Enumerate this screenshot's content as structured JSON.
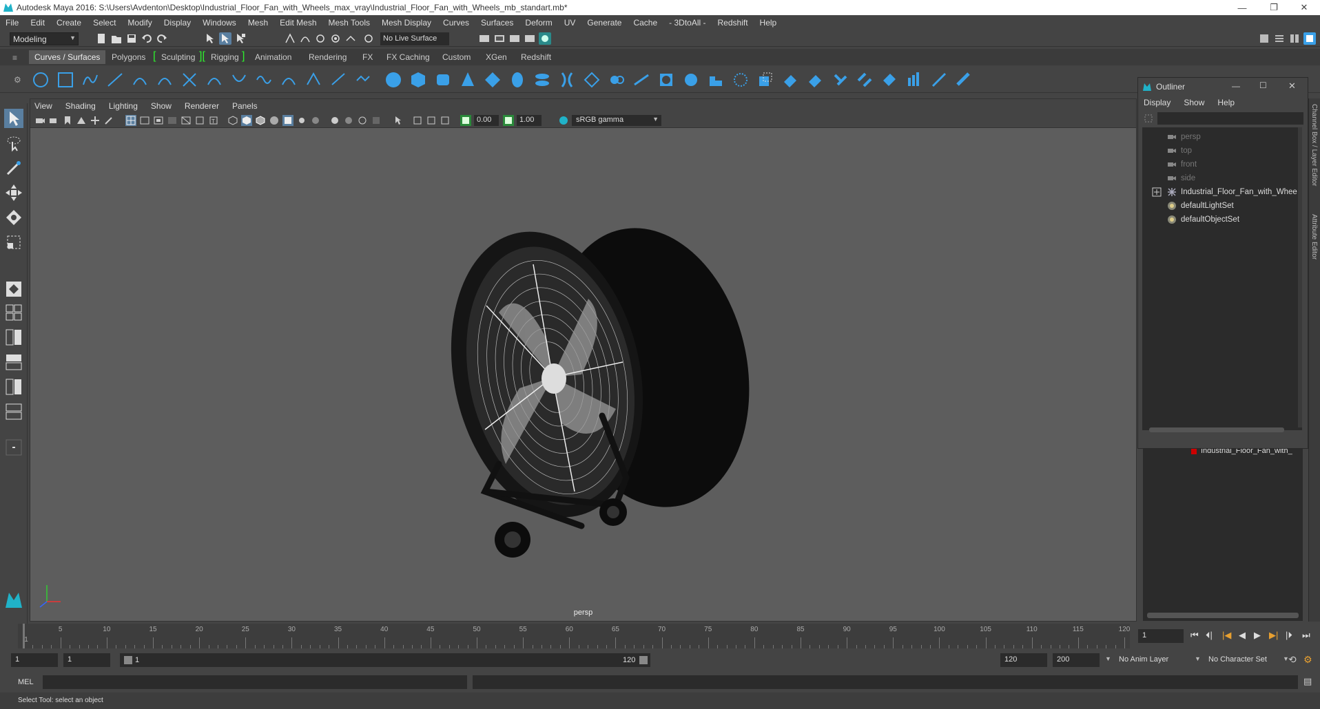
{
  "window": {
    "title": "Autodesk Maya 2016: S:\\Users\\Avdenton\\Desktop\\Industrial_Floor_Fan_with_Wheels_max_vray\\Industrial_Floor_Fan_with_Wheels_mb_standart.mb*",
    "minimize": "—",
    "maximize": "❐",
    "close": "✕"
  },
  "menubar": [
    "File",
    "Edit",
    "Create",
    "Select",
    "Modify",
    "Display",
    "Windows",
    "Mesh",
    "Edit Mesh",
    "Mesh Tools",
    "Mesh Display",
    "Curves",
    "Surfaces",
    "Deform",
    "UV",
    "Generate",
    "Cache",
    "- 3DtoAll -",
    "Redshift",
    "Help"
  ],
  "statusline": {
    "mode": "Modeling",
    "live_surface": "No Live Surface"
  },
  "shelf_tabs": [
    "Curves / Surfaces",
    "Polygons",
    "Sculpting",
    "Rigging",
    "Animation",
    "Rendering",
    "FX",
    "FX Caching",
    "Custom",
    "XGen",
    "Redshift"
  ],
  "viewport": {
    "menu": [
      "View",
      "Shading",
      "Lighting",
      "Show",
      "Renderer",
      "Panels"
    ],
    "exposure": "0.00",
    "gamma": "1.00",
    "color_space": "sRGB gamma",
    "camera": "persp"
  },
  "outliner": {
    "title": "Outliner",
    "menu": [
      "Display",
      "Show",
      "Help"
    ],
    "items": [
      {
        "label": "persp",
        "dim": true,
        "icon": "camera-icon"
      },
      {
        "label": "top",
        "dim": true,
        "icon": "camera-icon"
      },
      {
        "label": "front",
        "dim": true,
        "icon": "camera-icon"
      },
      {
        "label": "side",
        "dim": true,
        "icon": "camera-icon"
      },
      {
        "label": "Industrial_Floor_Fan_with_Whee",
        "dim": false,
        "icon": "group-icon"
      },
      {
        "label": "defaultLightSet",
        "dim": false,
        "icon": "set-icon"
      },
      {
        "label": "defaultObjectSet",
        "dim": false,
        "icon": "set-icon"
      }
    ]
  },
  "layer_panel": {
    "layer_name": "Industrial_Floor_Fan_with_"
  },
  "right_strip": {
    "channel_box": "Channel Box / Layer Editor",
    "attribute_editor": "Attribute Editor"
  },
  "timeslider": {
    "ticks": [
      1,
      5,
      10,
      15,
      20,
      25,
      30,
      35,
      40,
      45,
      50,
      55,
      60,
      65,
      70,
      75,
      80,
      85,
      90,
      95,
      100,
      105,
      110,
      115,
      120
    ],
    "current_frame": "1"
  },
  "range": {
    "start": "1",
    "playback_start": "1",
    "slider_start": "1",
    "slider_end": "120",
    "playback_end": "120",
    "end": "200",
    "anim_layer": "No Anim Layer",
    "character_set": "No Character Set"
  },
  "cmdline": {
    "label": "MEL"
  },
  "helpline": {
    "text": "Select Tool: select an object"
  },
  "colors": {
    "accent_green": "#2ef02e",
    "maya_teal": "#20b2c8",
    "shelf_blue": "#3aa0e8"
  }
}
